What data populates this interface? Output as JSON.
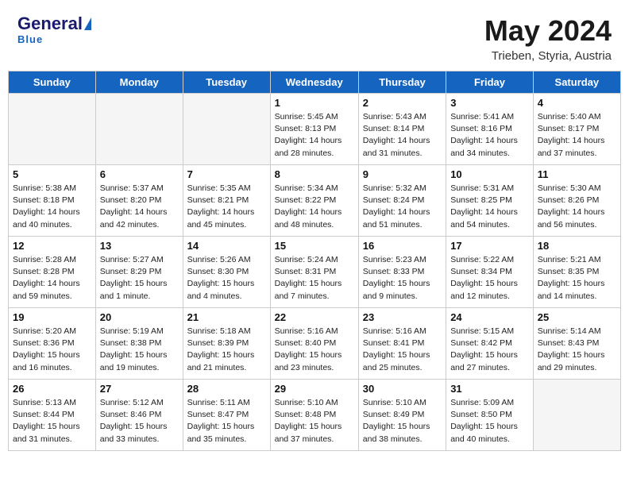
{
  "header": {
    "logo_line1": "General",
    "logo_line2": "Blue",
    "month_title": "May 2024",
    "location": "Trieben, Styria, Austria"
  },
  "weekdays": [
    "Sunday",
    "Monday",
    "Tuesday",
    "Wednesday",
    "Thursday",
    "Friday",
    "Saturday"
  ],
  "weeks": [
    [
      {
        "day": "",
        "info": ""
      },
      {
        "day": "",
        "info": ""
      },
      {
        "day": "",
        "info": ""
      },
      {
        "day": "1",
        "info": "Sunrise: 5:45 AM\nSunset: 8:13 PM\nDaylight: 14 hours\nand 28 minutes."
      },
      {
        "day": "2",
        "info": "Sunrise: 5:43 AM\nSunset: 8:14 PM\nDaylight: 14 hours\nand 31 minutes."
      },
      {
        "day": "3",
        "info": "Sunrise: 5:41 AM\nSunset: 8:16 PM\nDaylight: 14 hours\nand 34 minutes."
      },
      {
        "day": "4",
        "info": "Sunrise: 5:40 AM\nSunset: 8:17 PM\nDaylight: 14 hours\nand 37 minutes."
      }
    ],
    [
      {
        "day": "5",
        "info": "Sunrise: 5:38 AM\nSunset: 8:18 PM\nDaylight: 14 hours\nand 40 minutes."
      },
      {
        "day": "6",
        "info": "Sunrise: 5:37 AM\nSunset: 8:20 PM\nDaylight: 14 hours\nand 42 minutes."
      },
      {
        "day": "7",
        "info": "Sunrise: 5:35 AM\nSunset: 8:21 PM\nDaylight: 14 hours\nand 45 minutes."
      },
      {
        "day": "8",
        "info": "Sunrise: 5:34 AM\nSunset: 8:22 PM\nDaylight: 14 hours\nand 48 minutes."
      },
      {
        "day": "9",
        "info": "Sunrise: 5:32 AM\nSunset: 8:24 PM\nDaylight: 14 hours\nand 51 minutes."
      },
      {
        "day": "10",
        "info": "Sunrise: 5:31 AM\nSunset: 8:25 PM\nDaylight: 14 hours\nand 54 minutes."
      },
      {
        "day": "11",
        "info": "Sunrise: 5:30 AM\nSunset: 8:26 PM\nDaylight: 14 hours\nand 56 minutes."
      }
    ],
    [
      {
        "day": "12",
        "info": "Sunrise: 5:28 AM\nSunset: 8:28 PM\nDaylight: 14 hours\nand 59 minutes."
      },
      {
        "day": "13",
        "info": "Sunrise: 5:27 AM\nSunset: 8:29 PM\nDaylight: 15 hours\nand 1 minute."
      },
      {
        "day": "14",
        "info": "Sunrise: 5:26 AM\nSunset: 8:30 PM\nDaylight: 15 hours\nand 4 minutes."
      },
      {
        "day": "15",
        "info": "Sunrise: 5:24 AM\nSunset: 8:31 PM\nDaylight: 15 hours\nand 7 minutes."
      },
      {
        "day": "16",
        "info": "Sunrise: 5:23 AM\nSunset: 8:33 PM\nDaylight: 15 hours\nand 9 minutes."
      },
      {
        "day": "17",
        "info": "Sunrise: 5:22 AM\nSunset: 8:34 PM\nDaylight: 15 hours\nand 12 minutes."
      },
      {
        "day": "18",
        "info": "Sunrise: 5:21 AM\nSunset: 8:35 PM\nDaylight: 15 hours\nand 14 minutes."
      }
    ],
    [
      {
        "day": "19",
        "info": "Sunrise: 5:20 AM\nSunset: 8:36 PM\nDaylight: 15 hours\nand 16 minutes."
      },
      {
        "day": "20",
        "info": "Sunrise: 5:19 AM\nSunset: 8:38 PM\nDaylight: 15 hours\nand 19 minutes."
      },
      {
        "day": "21",
        "info": "Sunrise: 5:18 AM\nSunset: 8:39 PM\nDaylight: 15 hours\nand 21 minutes."
      },
      {
        "day": "22",
        "info": "Sunrise: 5:16 AM\nSunset: 8:40 PM\nDaylight: 15 hours\nand 23 minutes."
      },
      {
        "day": "23",
        "info": "Sunrise: 5:16 AM\nSunset: 8:41 PM\nDaylight: 15 hours\nand 25 minutes."
      },
      {
        "day": "24",
        "info": "Sunrise: 5:15 AM\nSunset: 8:42 PM\nDaylight: 15 hours\nand 27 minutes."
      },
      {
        "day": "25",
        "info": "Sunrise: 5:14 AM\nSunset: 8:43 PM\nDaylight: 15 hours\nand 29 minutes."
      }
    ],
    [
      {
        "day": "26",
        "info": "Sunrise: 5:13 AM\nSunset: 8:44 PM\nDaylight: 15 hours\nand 31 minutes."
      },
      {
        "day": "27",
        "info": "Sunrise: 5:12 AM\nSunset: 8:46 PM\nDaylight: 15 hours\nand 33 minutes."
      },
      {
        "day": "28",
        "info": "Sunrise: 5:11 AM\nSunset: 8:47 PM\nDaylight: 15 hours\nand 35 minutes."
      },
      {
        "day": "29",
        "info": "Sunrise: 5:10 AM\nSunset: 8:48 PM\nDaylight: 15 hours\nand 37 minutes."
      },
      {
        "day": "30",
        "info": "Sunrise: 5:10 AM\nSunset: 8:49 PM\nDaylight: 15 hours\nand 38 minutes."
      },
      {
        "day": "31",
        "info": "Sunrise: 5:09 AM\nSunset: 8:50 PM\nDaylight: 15 hours\nand 40 minutes."
      },
      {
        "day": "",
        "info": ""
      }
    ]
  ]
}
